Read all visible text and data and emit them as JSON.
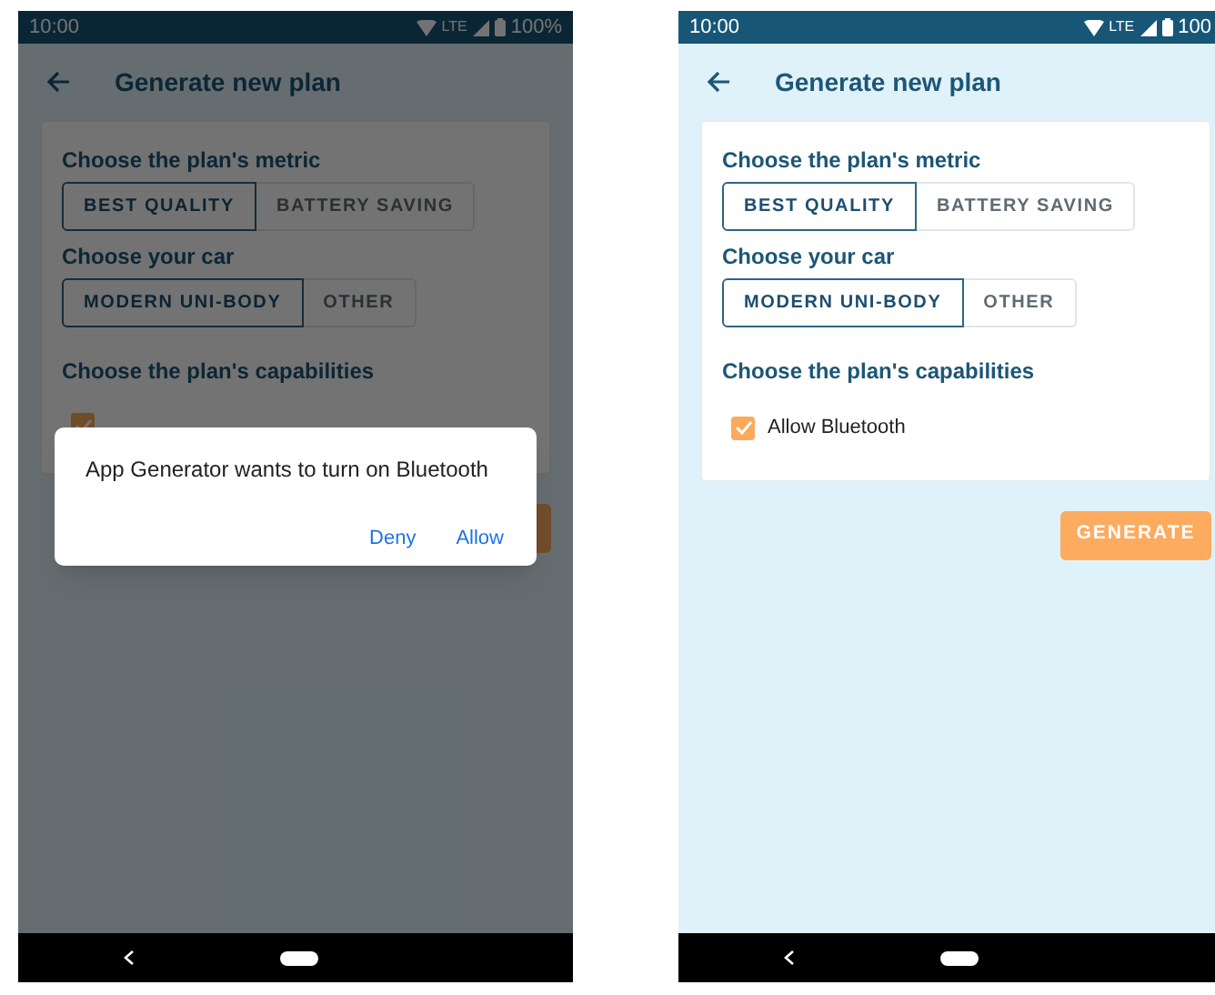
{
  "screens": [
    {
      "status_bar": {
        "time": "10:00",
        "network": "LTE",
        "battery": "100%"
      },
      "title": "Generate new plan",
      "dimmed": true,
      "sections": [
        {
          "kind": "toggle_group",
          "heading": "Choose the plan's metric",
          "options": [
            {
              "label": "BEST QUALITY",
              "selected": true
            },
            {
              "label": "BATTERY SAVING",
              "selected": false
            }
          ]
        },
        {
          "kind": "toggle_group",
          "heading": "Choose your car",
          "options": [
            {
              "label": "MODERN UNI-BODY",
              "selected": true
            },
            {
              "label": "OTHER",
              "selected": false
            }
          ]
        },
        {
          "kind": "checkboxes",
          "heading": "Choose the plan's capabilities",
          "items": [
            {
              "checked": true
            }
          ]
        }
      ],
      "dialog": {
        "message": "App Generator wants to turn on Bluetooth",
        "buttons": [
          "Deny",
          "Allow"
        ]
      }
    },
    {
      "status_bar": {
        "time": "10:00",
        "network": "LTE",
        "battery": "100"
      },
      "title": "Generate new plan",
      "dimmed": false,
      "sections": [
        {
          "kind": "toggle_group",
          "heading": "Choose the plan's metric",
          "options": [
            {
              "label": "BEST QUALITY",
              "selected": true
            },
            {
              "label": "BATTERY SAVING",
              "selected": false
            }
          ]
        },
        {
          "kind": "toggle_group",
          "heading": "Choose your car",
          "options": [
            {
              "label": "MODERN UNI-BODY",
              "selected": true
            },
            {
              "label": "OTHER",
              "selected": false
            }
          ]
        },
        {
          "kind": "checkboxes",
          "heading": "Choose the plan's capabilities",
          "items": [
            {
              "label": "Allow Bluetooth",
              "checked": true
            }
          ]
        }
      ],
      "generate_button": {
        "label": "GENERATE"
      }
    }
  ]
}
